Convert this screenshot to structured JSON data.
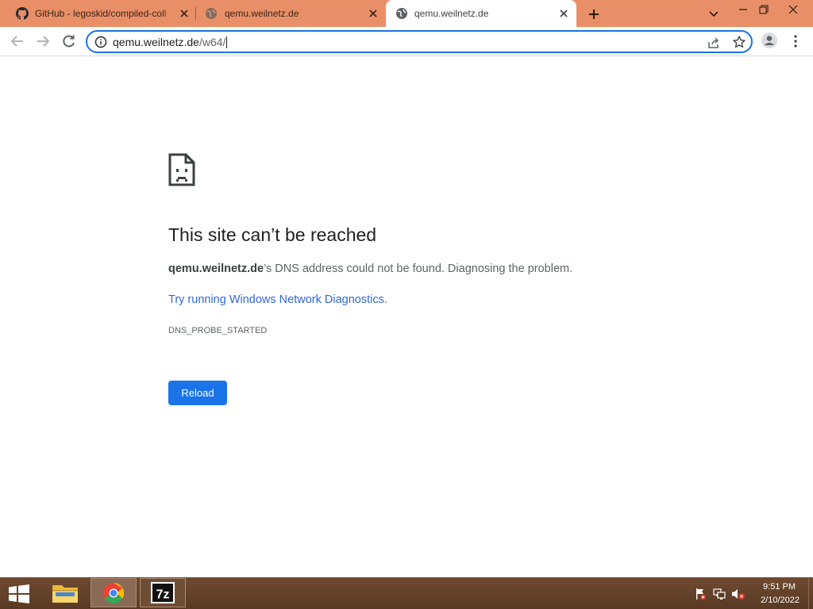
{
  "tabs": [
    {
      "title": "GitHub - legoskid/compiled-coll",
      "favicon": "github-icon",
      "active": false
    },
    {
      "title": "qemu.weilnetz.de",
      "favicon": "globe-icon",
      "active": false
    },
    {
      "title": "qemu.weilnetz.de",
      "favicon": "globe-icon",
      "active": true
    }
  ],
  "toolbar": {
    "url_host": "qemu.weilnetz.de",
    "url_path": "/w64/"
  },
  "error": {
    "heading": "This site can’t be reached",
    "host": "qemu.weilnetz.de",
    "description_suffix": "’s DNS address could not be found. Diagnosing the problem.",
    "prefix": "Try running ",
    "link": "Windows Network Diagnostics",
    "suffix": ".",
    "code": "DNS_PROBE_STARTED",
    "button_label": "Reload"
  },
  "taskbar": {
    "apps": [
      "file-explorer",
      "google-chrome",
      "7-zip"
    ],
    "clock_time": "9:51 PM",
    "clock_date": "2/10/2022",
    "seven_zip_label": "7z"
  },
  "colors": {
    "tabstrip": "#e98f67",
    "accent": "#1a73e8",
    "link": "#3367d6",
    "taskbar": "#5a3a24"
  }
}
